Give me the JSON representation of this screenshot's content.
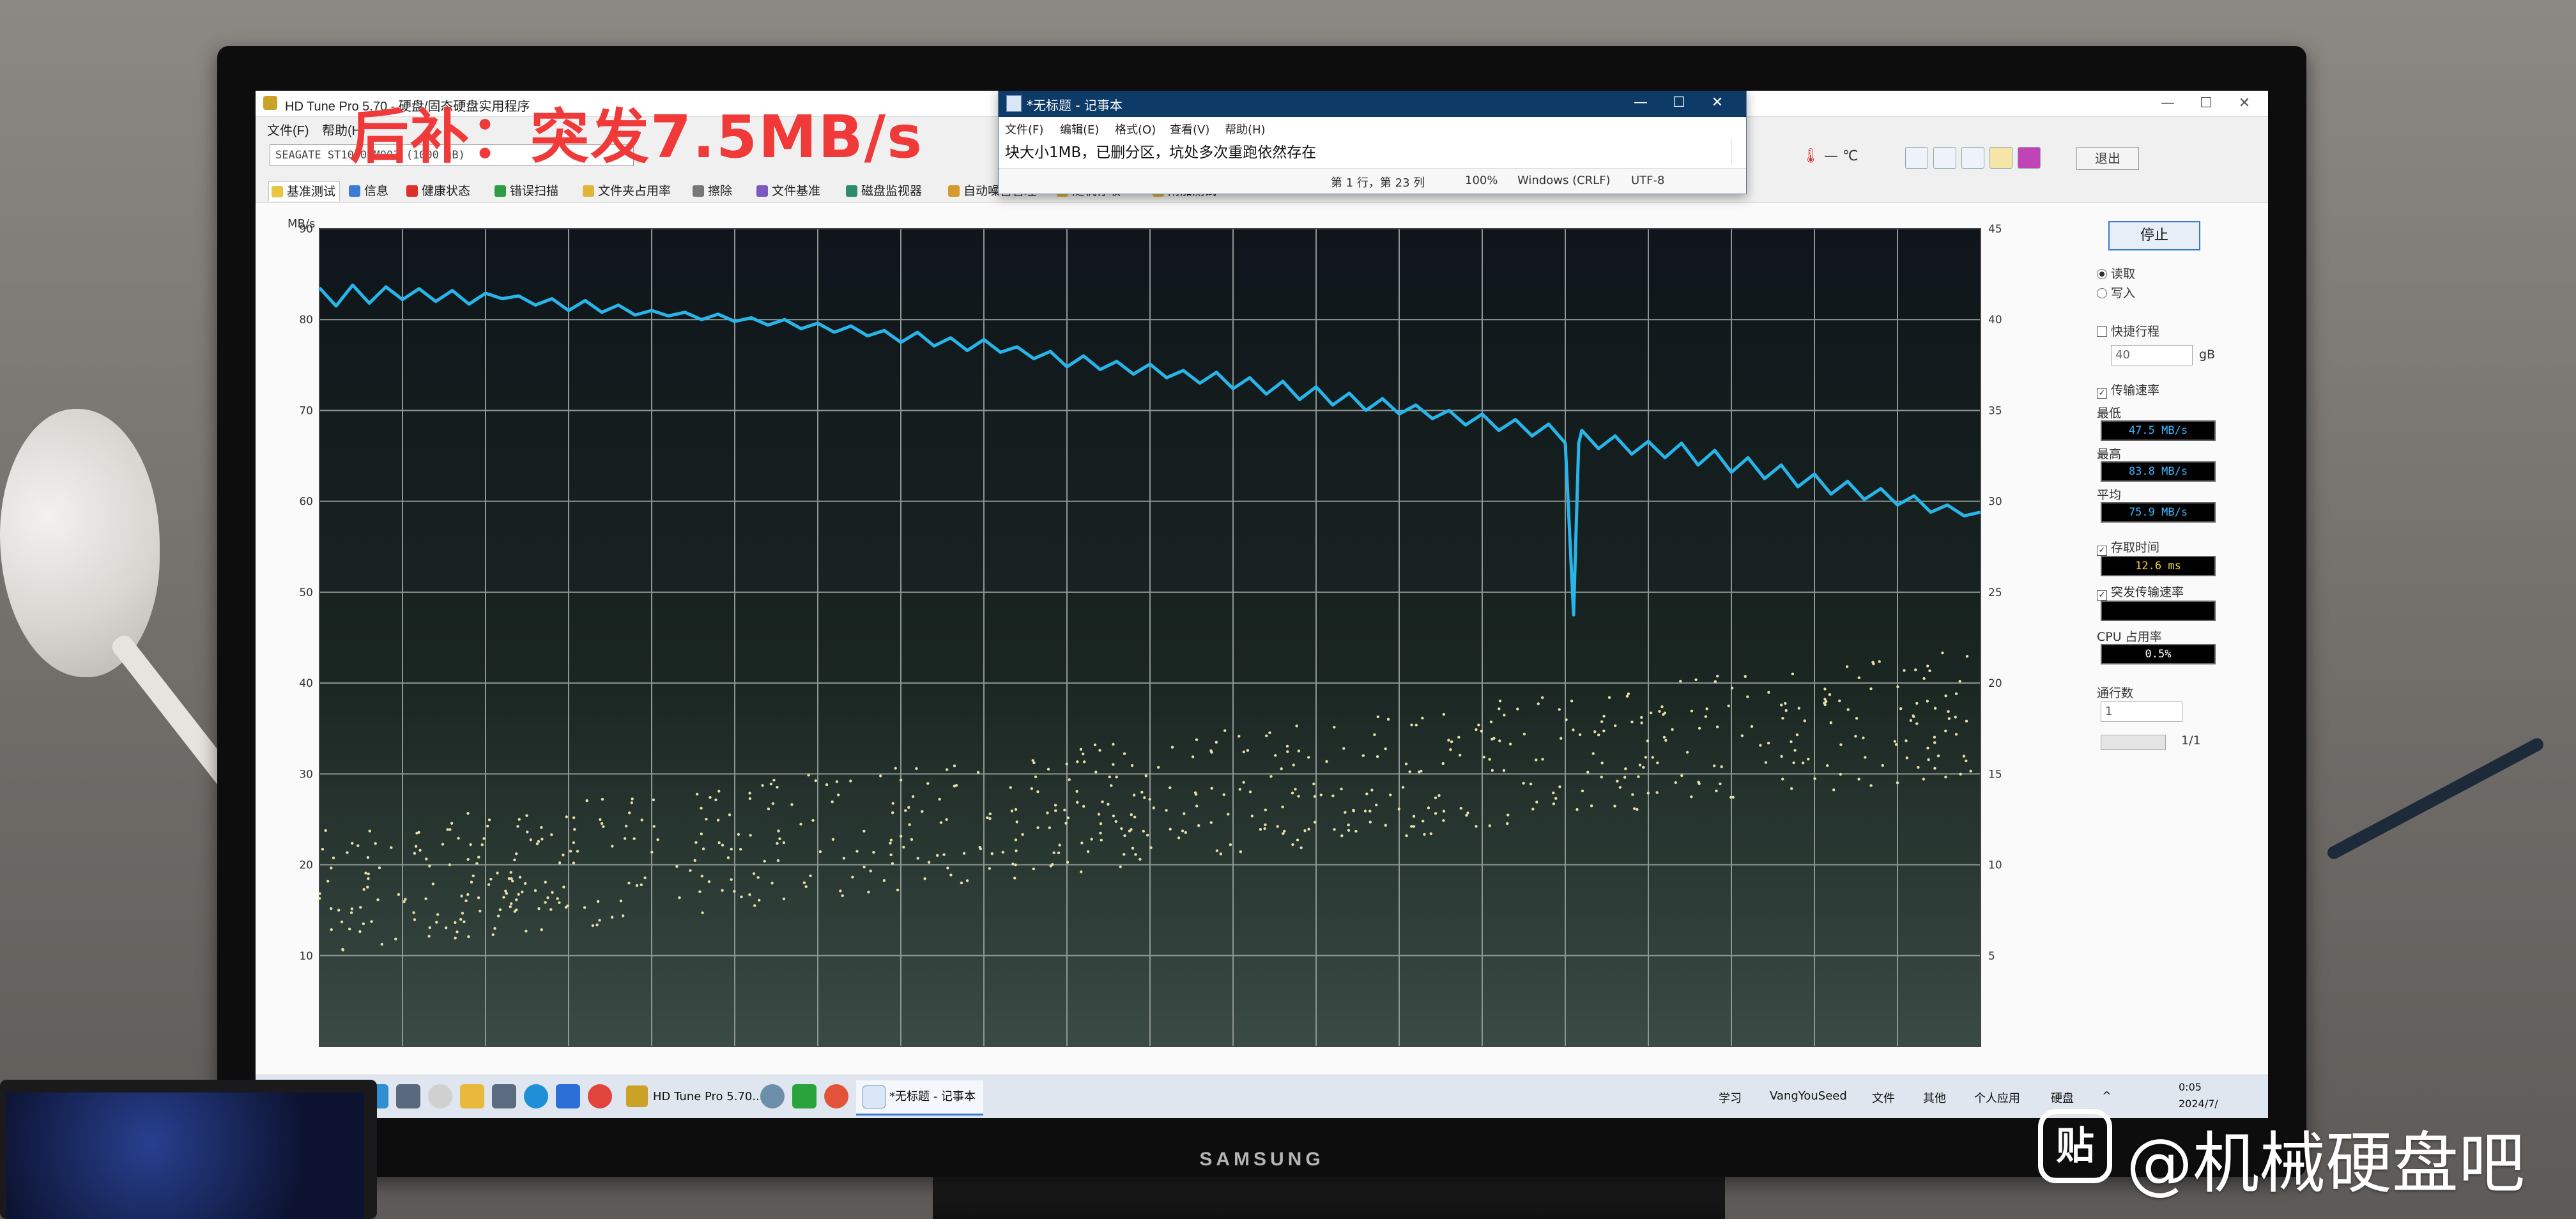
{
  "overlay": {
    "title": "后补：突发7.5MB/s",
    "watermark_icon_glyph": "贴",
    "watermark_text": "@机械硬盘吧"
  },
  "monitor": {
    "brand": "SAMSUNG"
  },
  "hdtune": {
    "title": "HD Tune Pro 5.70 - 硬盘/固态硬盘实用程序",
    "menu": [
      "文件(F)",
      "帮助(H)"
    ],
    "drive": "SEAGATE ST1000DM003 (1000 gB)",
    "temperature": "— ℃",
    "exit_label": "退出",
    "tabs": [
      "基准测试",
      "信息",
      "健康状态",
      "错误扫描",
      "文件夹占用率",
      "擦除",
      "文件基准",
      "磁盘监视器",
      "自动噪音管理",
      "随机存取",
      "附加测试"
    ],
    "y_unit": "MB/s",
    "panel": {
      "stop_label": "停止",
      "read_label": "读取",
      "write_label": "写入",
      "short_stroke_label": "快捷行程",
      "short_stroke_value": "40",
      "gb_unit": "gB",
      "transfer_rate_label": "传输速率",
      "min_label": "最低",
      "min_value": "47.5 MB/s",
      "max_label": "最高",
      "max_value": "83.8 MB/s",
      "avg_label": "平均",
      "avg_value": "75.9 MB/s",
      "access_time_label": "存取时间",
      "access_time_value": "12.6 ms",
      "burst_label": "突发传输速率",
      "burst_value": "",
      "cpu_label": "CPU 占用率",
      "cpu_value": "0.5%",
      "passes_label": "通行数",
      "passes_value": "1",
      "pass_count": "1/1"
    }
  },
  "notepad": {
    "title": "*无标题 - 记事本",
    "menu": [
      "文件(F)",
      "编辑(E)",
      "格式(O)",
      "查看(V)",
      "帮助(H)"
    ],
    "text": "块大小1MB，已删分区，坑处多次重跑依然存在",
    "status_position": "第 1 行，第 23 列",
    "status_zoom": "100%",
    "status_eol": "Windows (CRLF)",
    "status_encoding": "UTF-8"
  },
  "taskbar": {
    "apps": [
      "HD Tune Pro 5.70...",
      "*无标题 - 记事本"
    ],
    "toolbar_labels": [
      "学习",
      "VangYouSeed",
      "文件",
      "其他",
      "个人应用",
      "硬盘"
    ],
    "clock_time": "0:05",
    "clock_date": "2024/7/"
  },
  "chart_data": {
    "type": "line",
    "title": "",
    "ylabel": "MB/s",
    "y_left_range": [
      0,
      90
    ],
    "y_left_ticks": [
      10,
      20,
      30,
      40,
      50,
      60,
      70,
      80,
      90
    ],
    "y_right_range": [
      0,
      45
    ],
    "y_right_ticks": [
      5,
      10,
      15,
      20,
      25,
      30,
      35,
      40,
      45
    ],
    "x_range": [
      0,
      100
    ],
    "grid": true,
    "series": [
      {
        "unit": "MB/s",
        "x": [
          0,
          1,
          2,
          3,
          4,
          5,
          6,
          7,
          8,
          9,
          10,
          11,
          12,
          13,
          14,
          15,
          16,
          17,
          18,
          19,
          20,
          21,
          22,
          23,
          24,
          25,
          26,
          27,
          28,
          29,
          30,
          31,
          32,
          33,
          34,
          35,
          36,
          37,
          38,
          39,
          40,
          41,
          42,
          43,
          44,
          45,
          46,
          47,
          48,
          49,
          50,
          51,
          52,
          53,
          54,
          55,
          56,
          57,
          58,
          59,
          60,
          61,
          62,
          63,
          64,
          65,
          66,
          67,
          68,
          69,
          70,
          71,
          72,
          73,
          74,
          75,
          76,
          77,
          78,
          79,
          80,
          81,
          82,
          83,
          84,
          85,
          86,
          87,
          88,
          89,
          90,
          91,
          92,
          93,
          94,
          95,
          96,
          97,
          98,
          99,
          100
        ],
        "y": [
          83.5,
          81.5,
          83.8,
          81.8,
          83.6,
          82.2,
          83.4,
          82.0,
          83.2,
          81.7,
          82.9,
          82.3,
          82.6,
          81.6,
          82.3,
          81.0,
          82.1,
          80.8,
          81.6,
          80.5,
          81.0,
          80.4,
          80.8,
          80.0,
          80.6,
          79.8,
          80.2,
          79.4,
          80.0,
          79.0,
          79.6,
          78.6,
          79.3,
          78.2,
          78.8,
          77.5,
          78.6,
          77.1,
          78.0,
          76.6,
          77.8,
          76.4,
          77.0,
          75.7,
          76.5,
          74.8,
          76.0,
          74.5,
          75.4,
          74.0,
          75.1,
          73.6,
          74.4,
          73.0,
          74.2,
          72.4,
          73.6,
          71.8,
          73.2,
          71.2,
          72.6,
          70.6,
          71.9,
          70.0,
          71.3,
          69.6,
          70.6,
          69.1,
          70.0,
          68.4,
          69.6,
          67.8,
          69.0,
          67.2,
          68.5,
          66.4,
          67.8,
          65.8,
          67.2,
          65.2,
          66.6,
          64.8,
          66.4,
          64.0,
          65.6,
          63.2,
          64.8,
          62.5,
          64.0,
          61.6,
          63.0,
          60.8,
          62.2,
          60.2,
          61.4,
          59.6,
          60.6,
          58.8,
          59.6,
          58.4,
          58.8
        ]
      }
    ],
    "dip": {
      "x": 75.5,
      "min": 47.5
    }
  }
}
